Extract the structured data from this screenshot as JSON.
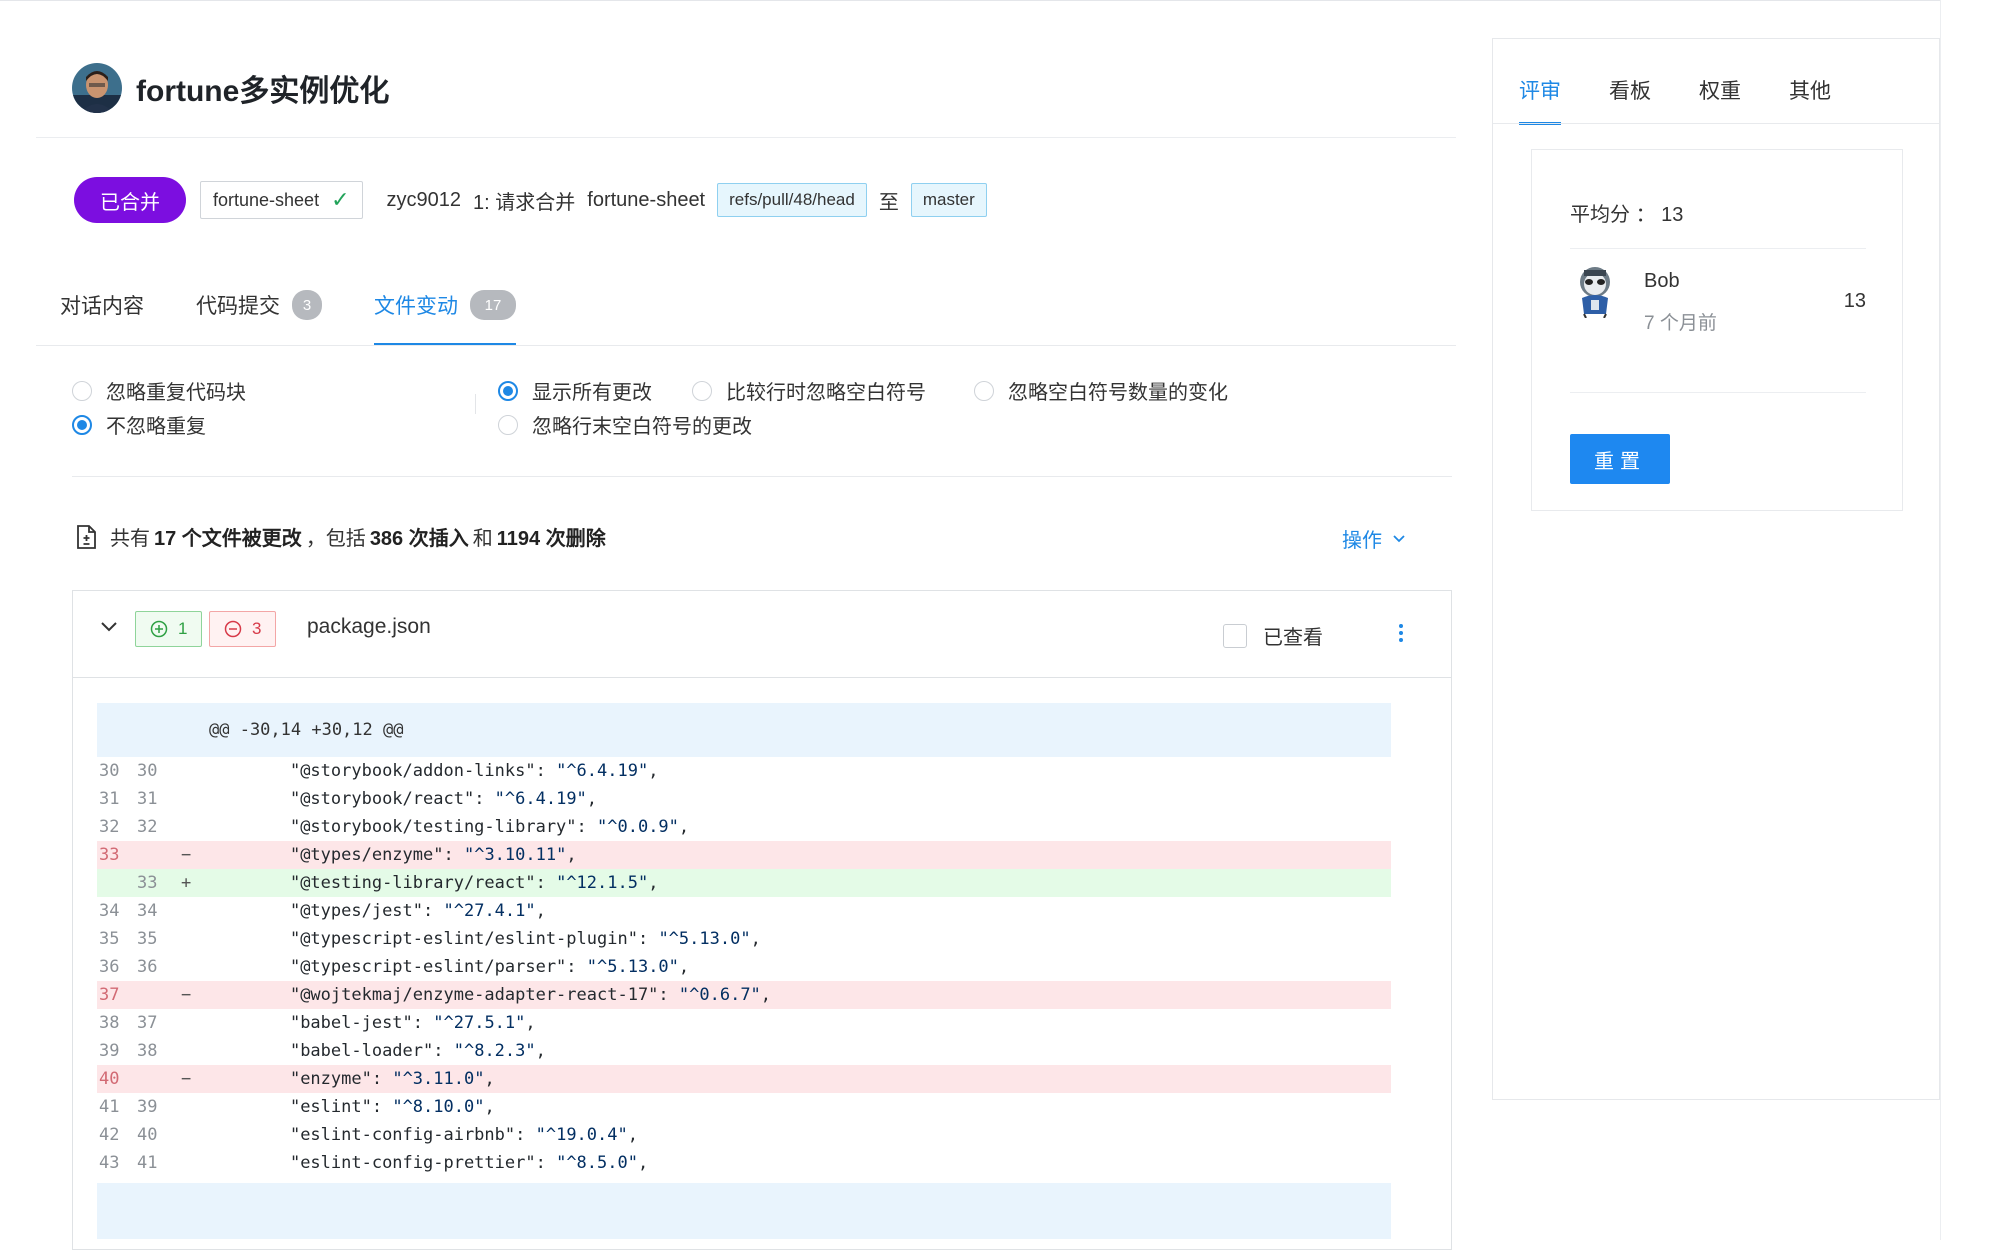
{
  "pr": {
    "title": "fortune多实例优化",
    "status_label": "已合并",
    "repo": "fortune-sheet",
    "author": "zyc9012",
    "merge_prefix": "1: 请求合并",
    "target_repo": "fortune-sheet",
    "source_ref": "refs/pull/48/head",
    "to_label": "至",
    "target_branch": "master"
  },
  "tabs": [
    {
      "label": "对话内容",
      "count": null
    },
    {
      "label": "代码提交",
      "count": "3"
    },
    {
      "label": "文件变动",
      "count": "17",
      "active": true
    }
  ],
  "options": {
    "dup": [
      {
        "label": "忽略重复代码块",
        "checked": false
      },
      {
        "label": "不忽略重复",
        "checked": true
      }
    ],
    "ws": [
      {
        "label": "显示所有更改",
        "checked": true
      },
      {
        "label": "比较行时忽略空白符号",
        "checked": false
      },
      {
        "label": "忽略空白符号数量的变化",
        "checked": false
      },
      {
        "label": "忽略行末空白符号的更改",
        "checked": false
      }
    ]
  },
  "summary": {
    "prefix": "共有",
    "files": "17 个文件被更改",
    "mid": "，包括",
    "insertions": "386 次插入",
    "and": "和",
    "deletions": "1194 次删除",
    "ops_label": "操作"
  },
  "file": {
    "additions": "1",
    "deletions": "3",
    "name": "package.json",
    "viewed_label": "已查看",
    "hunk_header": "@@ -30,14 +30,12 @@",
    "lines": [
      {
        "old": "30",
        "new": "30",
        "mark": "",
        "type": "ctx",
        "key": "\"@storybook/addon-links\"",
        "val": "\"^6.4.19\""
      },
      {
        "old": "31",
        "new": "31",
        "mark": "",
        "type": "ctx",
        "key": "\"@storybook/react\"",
        "val": "\"^6.4.19\""
      },
      {
        "old": "32",
        "new": "32",
        "mark": "",
        "type": "ctx",
        "key": "\"@storybook/testing-library\"",
        "val": "\"^0.0.9\""
      },
      {
        "old": "33",
        "new": "",
        "mark": "−",
        "type": "del",
        "key": "\"@types/enzyme\"",
        "val": "\"^3.10.11\""
      },
      {
        "old": "",
        "new": "33",
        "mark": "+",
        "type": "add",
        "key": "\"@testing-library/react\"",
        "val": "\"^12.1.5\""
      },
      {
        "old": "34",
        "new": "34",
        "mark": "",
        "type": "ctx",
        "key": "\"@types/jest\"",
        "val": "\"^27.4.1\""
      },
      {
        "old": "35",
        "new": "35",
        "mark": "",
        "type": "ctx",
        "key": "\"@typescript-eslint/eslint-plugin\"",
        "val": "\"^5.13.0\""
      },
      {
        "old": "36",
        "new": "36",
        "mark": "",
        "type": "ctx",
        "key": "\"@typescript-eslint/parser\"",
        "val": "\"^5.13.0\""
      },
      {
        "old": "37",
        "new": "",
        "mark": "−",
        "type": "del",
        "key": "\"@wojtekmaj/enzyme-adapter-react-17\"",
        "val": "\"^0.6.7\""
      },
      {
        "old": "38",
        "new": "37",
        "mark": "",
        "type": "ctx",
        "key": "\"babel-jest\"",
        "val": "\"^27.5.1\""
      },
      {
        "old": "39",
        "new": "38",
        "mark": "",
        "type": "ctx",
        "key": "\"babel-loader\"",
        "val": "\"^8.2.3\""
      },
      {
        "old": "40",
        "new": "",
        "mark": "−",
        "type": "del",
        "key": "\"enzyme\"",
        "val": "\"^3.11.0\""
      },
      {
        "old": "41",
        "new": "39",
        "mark": "",
        "type": "ctx",
        "key": "\"eslint\"",
        "val": "\"^8.10.0\""
      },
      {
        "old": "42",
        "new": "40",
        "mark": "",
        "type": "ctx",
        "key": "\"eslint-config-airbnb\"",
        "val": "\"^19.0.4\""
      },
      {
        "old": "43",
        "new": "41",
        "mark": "",
        "type": "ctx",
        "key": "\"eslint-config-prettier\"",
        "val": "\"^8.5.0\""
      }
    ]
  },
  "sidebar": {
    "tabs": [
      "评审",
      "看板",
      "权重",
      "其他"
    ],
    "avg_label": "平均分",
    "avg_sep": "：",
    "avg_value": "13",
    "reviewer": {
      "name": "Bob",
      "time": "7 个月前",
      "score": "13"
    },
    "reset_label": "重置"
  },
  "colors": {
    "accent": "#1e88e5",
    "merged": "#7c0ee0",
    "add_bg": "#e4fbe7",
    "del_bg": "#fde6e8",
    "hunk_bg": "#e9f4fd"
  }
}
